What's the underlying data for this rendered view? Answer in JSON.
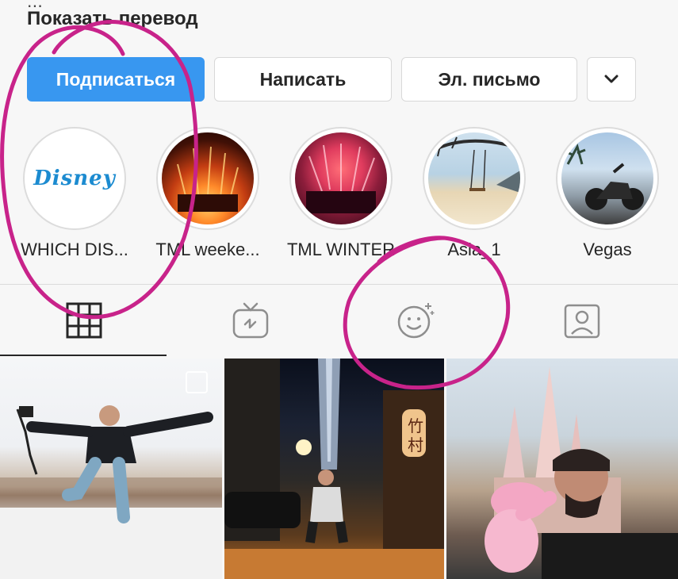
{
  "profile": {
    "translate_label": "Показать перевод"
  },
  "actions": {
    "follow_label": "Подписаться",
    "message_label": "Написать",
    "email_label": "Эл. письмо",
    "more_icon": "chevron-down-icon"
  },
  "highlights": [
    {
      "label": "WHICH DIS...",
      "cover_text": "Disney"
    },
    {
      "label": "TML weeke..."
    },
    {
      "label": "TML WINTER"
    },
    {
      "label": "Asia_1"
    },
    {
      "label": "Vegas"
    }
  ],
  "tabs": [
    {
      "icon": "grid-icon",
      "active": true
    },
    {
      "icon": "igtv-icon",
      "active": false
    },
    {
      "icon": "face-sparkle-icon",
      "active": false
    },
    {
      "icon": "tagged-person-icon",
      "active": false
    }
  ],
  "colors": {
    "follow_button": "#3897f0",
    "annotation": "#c8238a"
  }
}
